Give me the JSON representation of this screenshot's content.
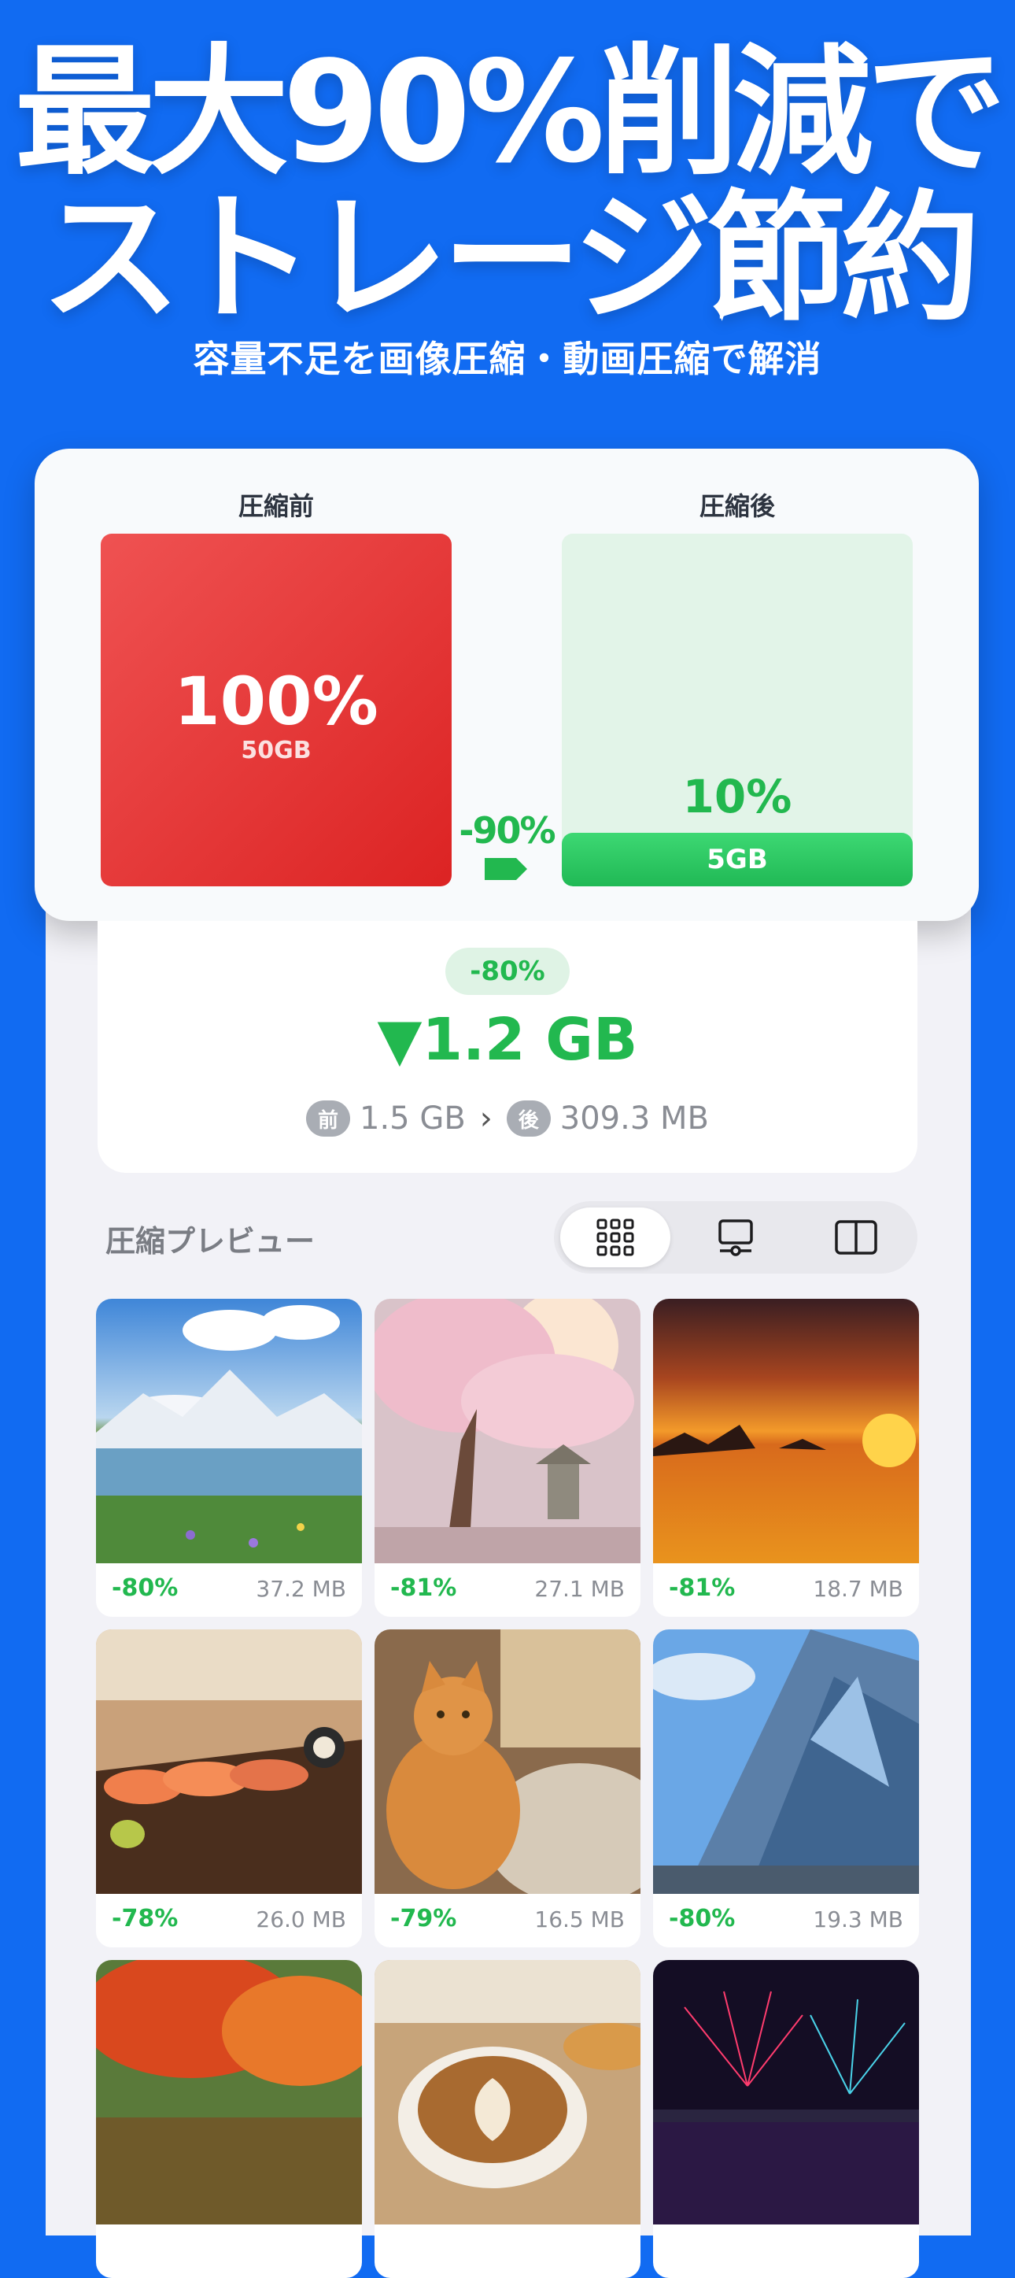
{
  "hero": {
    "title_line1": "最大90%削減で",
    "title_line2": "ストレージ節約",
    "subtitle": "容量不足を画像圧縮・動画圧縮で解消"
  },
  "compare": {
    "before_label": "圧縮前",
    "after_label": "圧縮後",
    "before_pct": "100%",
    "before_size": "50GB",
    "after_pct": "10%",
    "after_size": "5GB",
    "reduction": "-90%",
    "after_fill_fraction": 0.1
  },
  "savings": {
    "badge": "-80%",
    "saved": "▼1.2 GB",
    "before_tag": "前",
    "before_value": "1.5 GB",
    "after_tag": "後",
    "after_value": "309.3 MB"
  },
  "preview": {
    "title": "圧縮プレビュー",
    "view_modes": [
      "grid-view-icon",
      "list-view-icon",
      "compare-view-icon"
    ],
    "active_mode": "grid-view-icon"
  },
  "photos": [
    {
      "subject": "mountain-lake",
      "pct": "-80%",
      "size": "37.2 MB"
    },
    {
      "subject": "cherry-blossom",
      "pct": "-81%",
      "size": "27.1 MB"
    },
    {
      "subject": "sunset-sea",
      "pct": "-81%",
      "size": "18.7 MB"
    },
    {
      "subject": "sushi",
      "pct": "-78%",
      "size": "26.0 MB"
    },
    {
      "subject": "cat",
      "pct": "-79%",
      "size": "16.5 MB"
    },
    {
      "subject": "skyscraper",
      "pct": "-80%",
      "size": "19.3 MB"
    },
    {
      "subject": "autumn-garden",
      "pct": "",
      "size": ""
    },
    {
      "subject": "latte",
      "pct": "",
      "size": ""
    },
    {
      "subject": "fireworks",
      "pct": "",
      "size": ""
    }
  ],
  "colors": {
    "background": "#116bf2",
    "accent_green": "#22b84f",
    "before_red": "#dc2323"
  }
}
